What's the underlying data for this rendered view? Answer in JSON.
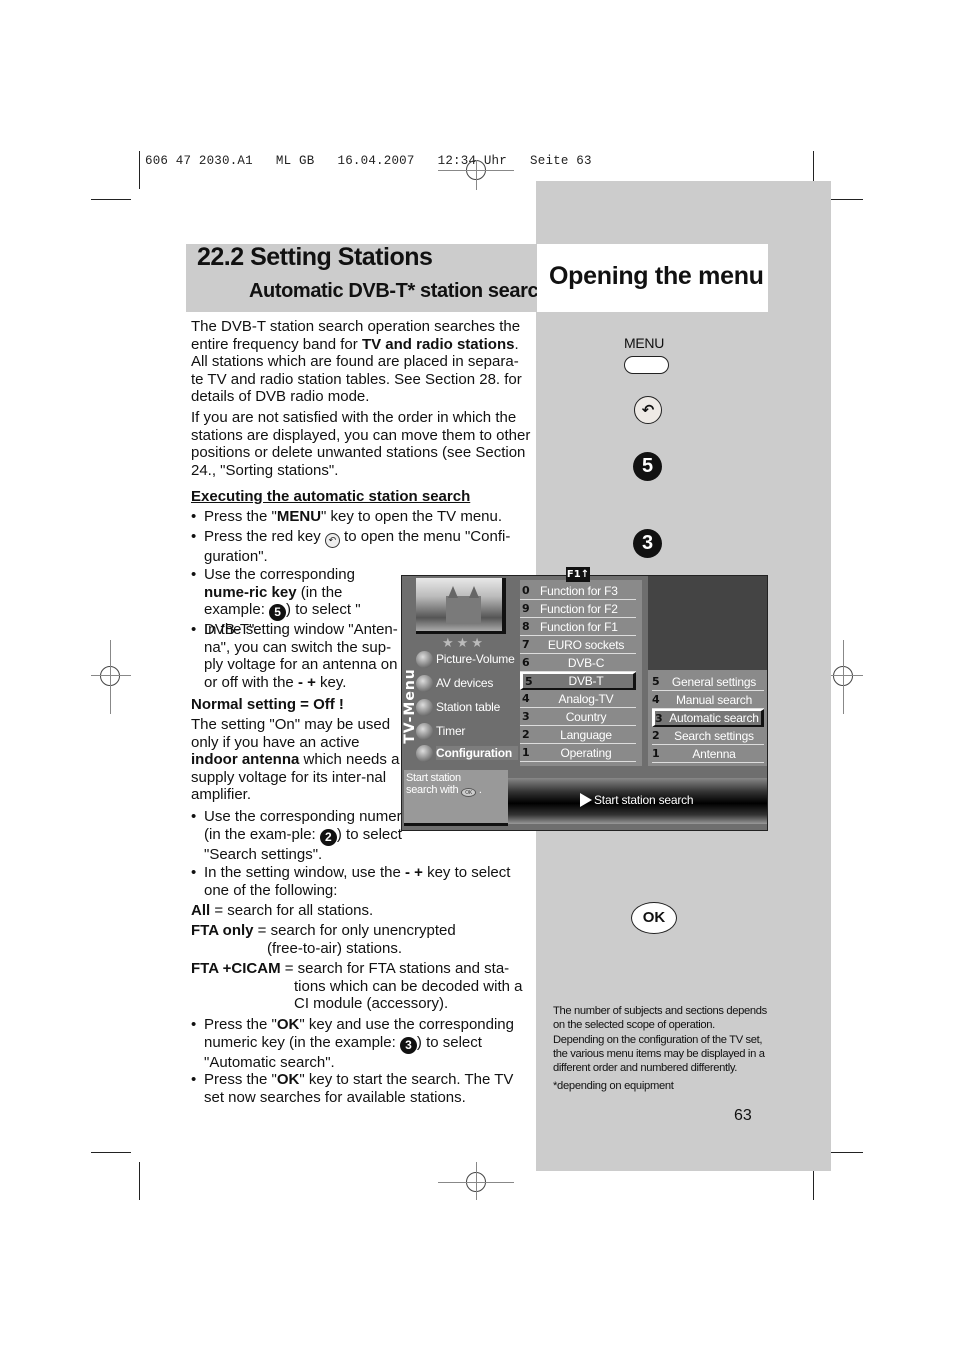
{
  "print_header": "606 47 2030.A1   ML GB   16.04.2007   12:34 Uhr   Seite 63",
  "header": {
    "section_title": "22.2 Setting Stations",
    "section_subtitle": "Automatic DVB-T* station search",
    "right_title": "Opening the menu"
  },
  "intro": {
    "p1_a": "The DVB-T station search operation searches the entire frequency band for ",
    "p1_bold": "TV and radio stations",
    "p1_b": ". All stations which are found are placed in separa-te TV and radio station tables. See Section 28. for details of DVB radio mode.",
    "p2": "If you are not satisfied with the order in which the stations are displayed, you can move them to other positions or delete unwanted stations (see Section 24., \"Sorting stations\"."
  },
  "procedure": {
    "heading": "Executing the automatic station search",
    "step1_a": "Press the \"",
    "step1_bold": "MENU",
    "step1_b": "\" key to open the TV menu.",
    "step2_a": "Press the red key ",
    "step2_icon": "↶",
    "step2_b": " to open the menu \"Confi-guration\".",
    "step3_a": "Use the corresponding ",
    "step3_bold": "nume-ric key",
    "step3_b": " (in the example: ",
    "step3_num": "5",
    "step3_c": ") to select \" DVB-T\".",
    "step4_a": "In the setting window \"Anten-na\", you can switch the sup-ply voltage for an antenna on or off with the ",
    "step4_keys": "- +",
    "step4_b": " key.",
    "normal_setting": "Normal setting = Off !",
    "note_a": "The setting \"On\" may be used only if you have an active ",
    "note_bold": "indoor antenna",
    "note_b": " which needs a supply voltage for its inter-nal amplifier.",
    "step5_a": "Use the corresponding numeric key (in the exam-ple: ",
    "step5_num": "2",
    "step5_b": ") to select \"Search settings\".",
    "step6_a": "In the setting window, use the ",
    "step6_keys": "- +",
    "step6_b": " key to select one of the following:",
    "options": [
      {
        "key": "All",
        "desc": " = search for all stations."
      },
      {
        "key": "FTA only",
        "desc": " = search for only unencrypted",
        "desc2": "(free-to-air) stations."
      },
      {
        "key": "FTA +CICAM",
        "desc": " = search for FTA stations and sta-",
        "desc2": "tions which can be decoded with a",
        "desc3": "CI module (accessory)."
      }
    ],
    "step7_a": "Press the \"",
    "step7_bold": "OK",
    "step7_b": "\" key and use the corresponding numeric key (in the example: ",
    "step7_num": "3",
    "step7_c": ") to select \"Automatic search\".",
    "step8_a": "Press the \"",
    "step8_bold": "OK",
    "step8_b": "\" key to start the search. The TV set now searches for available stations."
  },
  "remote": {
    "menu_label": "MENU",
    "back_icon": "↶",
    "num_5": "5",
    "num_3": "3",
    "ok_label": "OK"
  },
  "tv_menu": {
    "vertical_title": "TV-Menu",
    "stars": "★★★",
    "f1_tab": "F1↑",
    "main_items": [
      {
        "label": "Picture-Volume",
        "active": false
      },
      {
        "label": "AV devices",
        "active": false
      },
      {
        "label": "Station table",
        "active": false
      },
      {
        "label": "Timer",
        "active": false
      },
      {
        "label": "Configuration",
        "active": true
      }
    ],
    "config_items": [
      {
        "num": "0",
        "label": "Function for F3"
      },
      {
        "num": "9",
        "label": "Function for F2"
      },
      {
        "num": "8",
        "label": "Function for F1"
      },
      {
        "num": "7",
        "label": "EURO sockets"
      },
      {
        "num": "6",
        "label": "DVB-C"
      },
      {
        "num": "5",
        "label": "DVB-T",
        "selected": true
      },
      {
        "num": "4",
        "label": "Analog-TV"
      },
      {
        "num": "3",
        "label": "Country"
      },
      {
        "num": "2",
        "label": "Language"
      },
      {
        "num": "1",
        "label": "Operating"
      }
    ],
    "dvbt_items": [
      {
        "num": "5",
        "label": "General settings"
      },
      {
        "num": "4",
        "label": "Manual search"
      },
      {
        "num": "3",
        "label": "Automatic search",
        "selected": true
      },
      {
        "num": "2",
        "label": "Search settings"
      },
      {
        "num": "1",
        "label": "Antenna"
      }
    ],
    "help_line1": "Start station",
    "help_line2": "search with",
    "help_ok": "OK",
    "action": "Start station search"
  },
  "side_note": "The number of subjects and sections depends on the selected scope of operation. Depending on the configuration of the TV set, the various menu items may be displayed in a different order and numbered differently.",
  "footnote": "*depending on equipment",
  "page_number": "63"
}
